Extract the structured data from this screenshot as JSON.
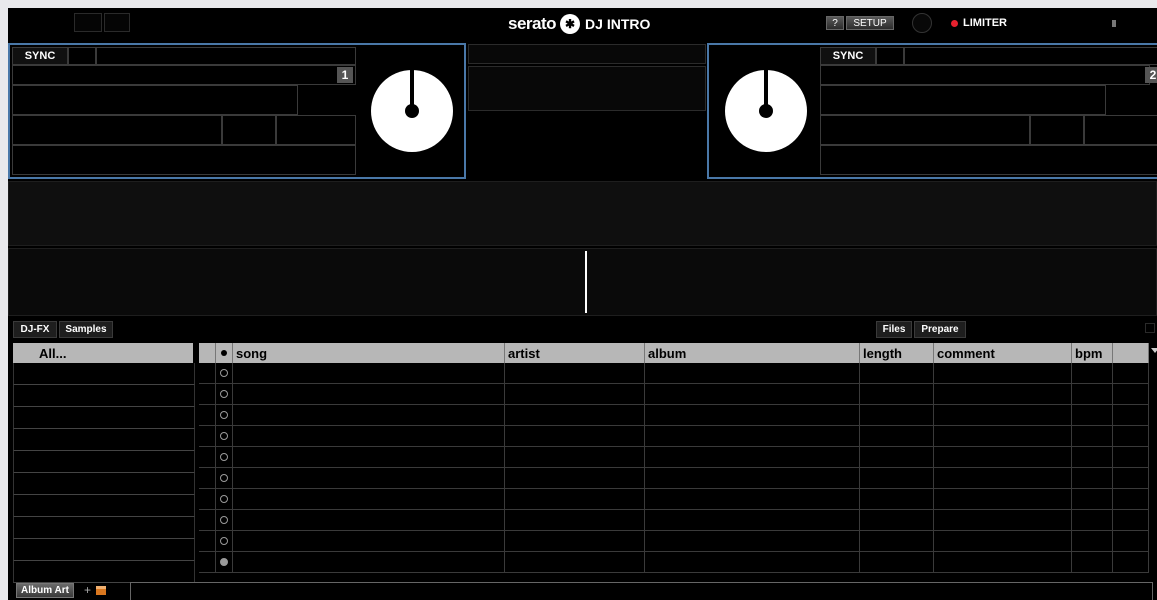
{
  "header": {
    "logo_brand": "serato",
    "logo_product": "DJ INTRO",
    "help_label": "?",
    "setup_label": "SETUP",
    "limiter_label": "LIMITER",
    "limiter_color": "#e6212e"
  },
  "deck_left": {
    "sync_label": "SYNC",
    "deck_number": "1"
  },
  "deck_right": {
    "sync_label": "SYNC",
    "deck_number": "2"
  },
  "panel_tabs": {
    "djfx": "DJ-FX",
    "samples": "Samples",
    "files": "Files",
    "prepare": "Prepare"
  },
  "crates": {
    "selected": "All..."
  },
  "library": {
    "columns": [
      "song",
      "artist",
      "album",
      "length",
      "comment",
      "bpm"
    ],
    "status_column_icon": "loaded-dot-icon",
    "row_count": 10
  },
  "footer": {
    "album_art_label": "Album Art",
    "add_label": "+"
  },
  "colors": {
    "deck_border": "#4a78a8",
    "header_bg": "#b7b7b7"
  }
}
